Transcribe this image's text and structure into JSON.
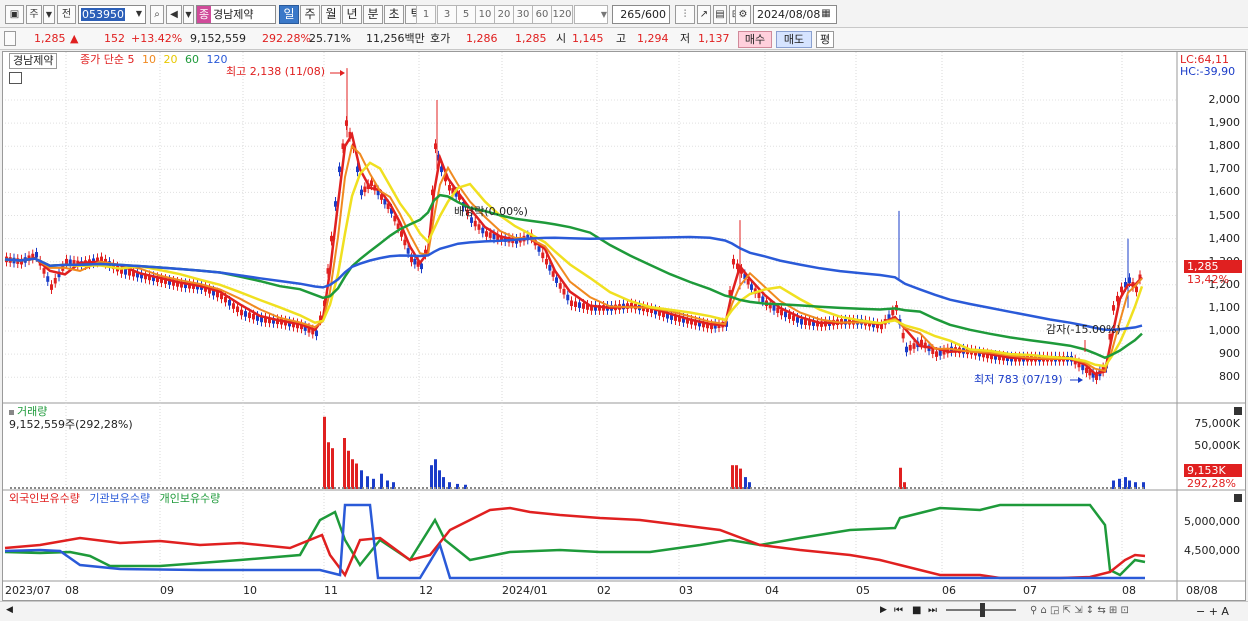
{
  "toolbar": {
    "week_label": "주",
    "prev_label": "전",
    "stock_code": "053950",
    "stock_marker": "종",
    "stock_name": "경남제약",
    "periods": [
      "일",
      "주",
      "월",
      "년",
      "분",
      "초",
      "틱"
    ],
    "active_period": "일",
    "numbers": [
      "1",
      "3",
      "5",
      "10",
      "20",
      "30",
      "60",
      "120"
    ],
    "count": "265",
    "count_total": "/600",
    "date": "2024/08/08"
  },
  "quote": {
    "price": "1,285",
    "arrow": "▲",
    "change": "152",
    "change_pct": "+13.42%",
    "volume": "9,152,559",
    "volume_pct": "292.28%",
    "turnover": "25.71%",
    "amount": "11,256백만",
    "hoga_label": "호가",
    "ask": "1,286",
    "bid": "1,285",
    "open_label": "시",
    "open": "1,145",
    "high_label": "고",
    "high": "1,294",
    "low_label": "저",
    "low": "1,137",
    "buy_label": "매수",
    "sell_label": "매도",
    "flat_label": "평"
  },
  "price_panel": {
    "stock_tag": "경남제약",
    "ma_title": "종가 단순",
    "ma_periods": [
      {
        "label": "5",
        "color": "#e02020"
      },
      {
        "label": "10",
        "color": "#f08a20"
      },
      {
        "label": "20",
        "color": "#e8d800"
      },
      {
        "label": "60",
        "color": "#1e9a3a"
      },
      {
        "label": "120",
        "color": "#2a5ad8"
      }
    ],
    "high_note": "최고 2,138 (11/08)",
    "low_note": "최저 783 (07/19)",
    "ex_note": "배당락(0.00%)",
    "reduction_note": "감자(-15.00%)",
    "lc": "LC:64,11",
    "hc": "HC:-39,90",
    "y_ticks": [
      "2,000",
      "1,900",
      "1,800",
      "1,700",
      "1,600",
      "1,500",
      "1,400",
      "1,300",
      "1,200",
      "1,100",
      "1,000",
      "900",
      "800"
    ],
    "last_price_tag": "1,285",
    "last_pct_tag": "13,42%"
  },
  "volume_panel": {
    "title": "거래량",
    "value": "9,152,559주(292,28%)",
    "y_ticks": [
      "75,000K",
      "50,000K"
    ],
    "last_tag": "9,153K",
    "last_pct": "292,28%"
  },
  "holdings_panel": {
    "series": [
      {
        "label": "외국인보유수량",
        "color": "#e02020"
      },
      {
        "label": "기관보유수량",
        "color": "#2a5ad8"
      },
      {
        "label": "개인보유수량",
        "color": "#1e9a3a"
      }
    ],
    "y_ticks": [
      "5,000,000",
      "4,500,000"
    ]
  },
  "x_axis": {
    "dates": [
      "2023/07",
      "08",
      "09",
      "10",
      "11",
      "12",
      "2024/01",
      "02",
      "03",
      "04",
      "05",
      "06",
      "07",
      "08",
      "08/08"
    ]
  },
  "colors": {
    "up": "#e02020",
    "down": "#1a3cc8",
    "ma5": "#e02020",
    "ma10": "#f08a20",
    "ma20": "#f0e020",
    "ma60": "#1e9a3a",
    "ma120": "#2a5ad8"
  }
}
